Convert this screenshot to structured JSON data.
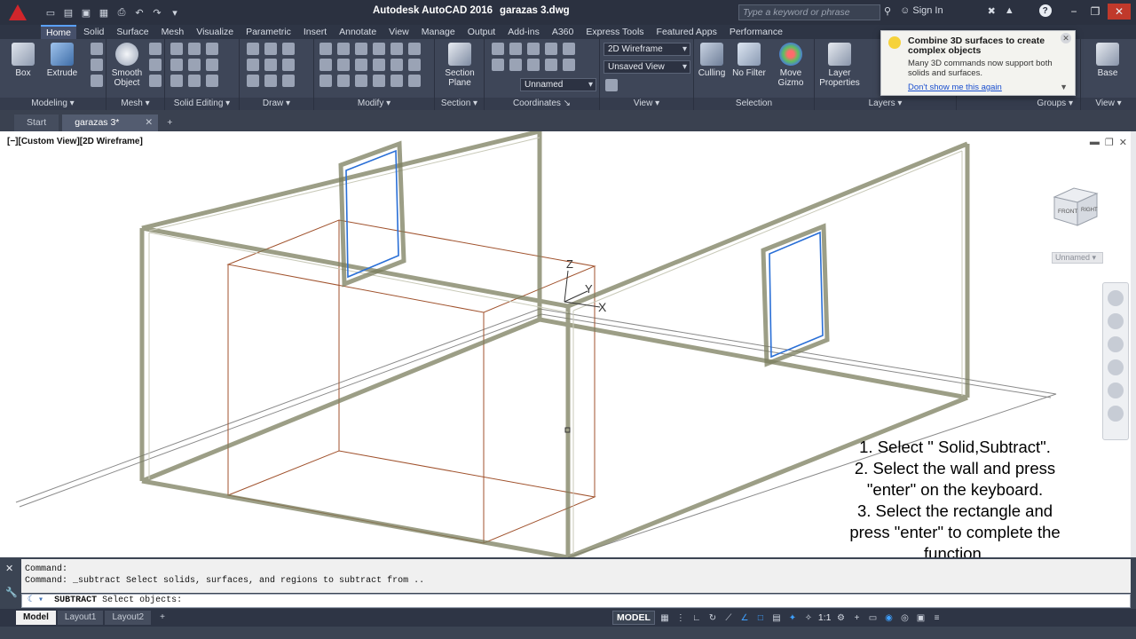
{
  "titlebar": {
    "app_name": "Autodesk AutoCAD 2016",
    "document": "garazas 3.dwg",
    "search_placeholder": "Type a keyword or phrase",
    "sign_in": "Sign In"
  },
  "ribbon_tabs": [
    "Home",
    "Solid",
    "Surface",
    "Mesh",
    "Visualize",
    "Parametric",
    "Insert",
    "Annotate",
    "View",
    "Manage",
    "Output",
    "Add-ins",
    "A360",
    "Express Tools",
    "Featured Apps",
    "Performance"
  ],
  "ribbon": {
    "tools": {
      "box": "Box",
      "extrude": "Extrude",
      "smooth_object": "Smooth Object",
      "section_plane": "Section Plane",
      "culling": "Culling",
      "no_filter": "No Filter",
      "move_gizmo": "Move Gizmo",
      "layer_properties": "Layer Properties",
      "base": "Base"
    },
    "combos": {
      "visual_style": "2D Wireframe",
      "view": "Unsaved View",
      "ucs": "Unnamed"
    },
    "panels": [
      "Modeling",
      "Mesh",
      "Solid Editing",
      "Draw",
      "Modify",
      "Section",
      "Coordinates",
      "View",
      "Selection",
      "Layers",
      "Groups",
      "View"
    ]
  },
  "notification": {
    "title": "Combine 3D surfaces to create complex objects",
    "body": "Many 3D commands now support both solids and surfaces.",
    "link": "Don't show me this again"
  },
  "file_tabs": {
    "start": "Start",
    "drawing": "garazas 3*"
  },
  "viewport": {
    "label": "[−][Custom View][2D Wireframe]",
    "ucs_name": "Unnamed",
    "cube_front": "FRONT",
    "cube_right": "RIGHT",
    "axis_x": "X",
    "axis_y": "Y",
    "axis_z": "Z"
  },
  "instructions": [
    "1. Select \" Solid,Subtract\".",
    "2. Select the wall and press",
    "\"enter\" on the keyboard.",
    "3. Select the rectangle and",
    "press \"enter\" to complete the",
    "function."
  ],
  "command": {
    "line1": "Command:",
    "line2": "Command: _subtract Select solids, surfaces, and regions to subtract from ..",
    "prompt_keyword": "SUBTRACT",
    "prompt_text": "Select objects:"
  },
  "layout_tabs": [
    "Model",
    "Layout1",
    "Layout2"
  ],
  "status": {
    "model": "MODEL",
    "scale": "1:1"
  }
}
